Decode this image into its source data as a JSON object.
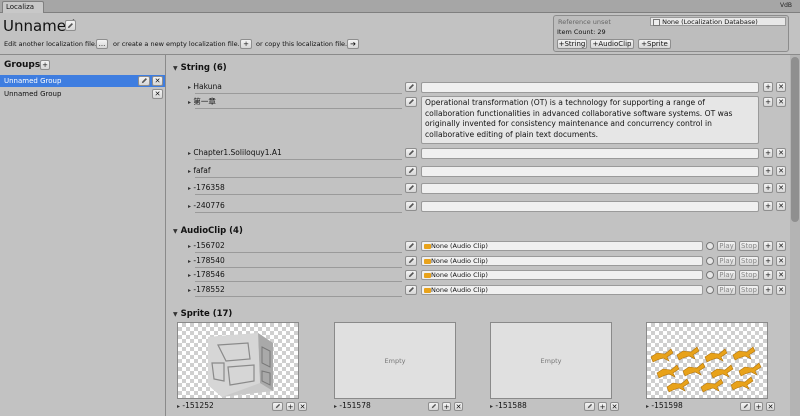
{
  "window": {
    "tab_label": "Localiza",
    "right_label": "VdB"
  },
  "header": {
    "title": "Unnamed",
    "edit_prefix": "Edit another localization file.",
    "browse_btn": "...",
    "create_text": "or create a new empty localization file.",
    "add_btn": "+",
    "copy_text": "or copy this localization file.",
    "copy_btn": "➔"
  },
  "ref_panel": {
    "reference_label": "Reference unset",
    "database_value": "None (Localization Database)",
    "item_count": "Item Count: 29",
    "add_string": "+String",
    "add_audioclip": "+AudioClip",
    "add_sprite": "+Sprite"
  },
  "groups": {
    "title": "Groups",
    "add_btn": "+",
    "items": [
      {
        "label": "Unnamed Group",
        "selected": true
      },
      {
        "label": "Unnamed Group",
        "selected": false
      }
    ]
  },
  "string_section": {
    "title": "String (6)",
    "items": [
      {
        "key": "Hakuna",
        "value": ""
      },
      {
        "key": "第一章",
        "value": "Operational transformation (OT) is a technology for supporting a range of collaboration functionalities in advanced collaborative software systems. OT was originally invented for consistency maintenance and concurrency control in collaborative editing of plain text documents."
      },
      {
        "key": "Chapter1.Soliloquy1.A1",
        "value": ""
      },
      {
        "key": "fafaf",
        "value": ""
      },
      {
        "key": "-176358",
        "value": ""
      },
      {
        "key": "-240776",
        "value": ""
      }
    ]
  },
  "audio_section": {
    "title": "AudioClip (4)",
    "play_label": "Play",
    "stop_label": "Stop",
    "items": [
      {
        "key": "-156702",
        "value": "None (Audio Clip)"
      },
      {
        "key": "-178540",
        "value": "None (Audio Clip)"
      },
      {
        "key": "-178546",
        "value": "None (Audio Clip)"
      },
      {
        "key": "-178552",
        "value": "None (Audio Clip)"
      }
    ]
  },
  "sprite_section": {
    "title": "Sprite (17)",
    "empty_label": "Empty",
    "items": [
      {
        "key": "-151252",
        "preview": "stone-cube"
      },
      {
        "key": "-151578",
        "preview": "empty"
      },
      {
        "key": "-151588",
        "preview": "empty"
      },
      {
        "key": "-151598",
        "preview": "running-animals"
      }
    ]
  },
  "icons": {
    "edit": "pencil-icon",
    "add": "+",
    "remove": "✕",
    "collapse": "▼",
    "expand": "▶"
  },
  "colors": {
    "selected_row": "#3e7de0",
    "panel_bg": "#c2c2c2",
    "field_bg": "#f0f0f0",
    "audio_icon": "#e8a21a"
  }
}
